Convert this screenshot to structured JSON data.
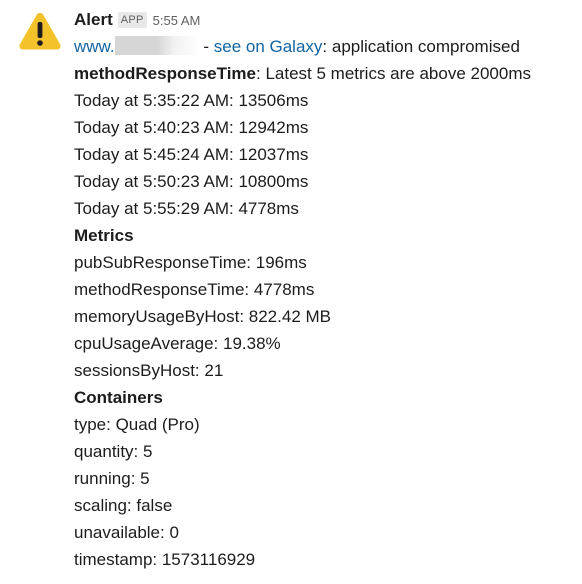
{
  "message": {
    "sender": "Alert",
    "badge": "APP",
    "time": "5:55 AM",
    "icon": "warning-icon",
    "icon_color": "#f4c22b"
  },
  "header_line": {
    "url_prefix": "www.",
    "separator": " - ",
    "galaxy_link": "see on Galaxy",
    "suffix": ": application compromised"
  },
  "alert": {
    "metric_name": "methodResponseTime",
    "metric_text": ": Latest 5 metrics are above 2000ms",
    "readings": [
      "Today at 5:35:22 AM: 13506ms",
      "Today at 5:40:23 AM: 12942ms",
      "Today at 5:45:24 AM: 12037ms",
      "Today at 5:50:23 AM: 10800ms",
      "Today at 5:55:29 AM: 4778ms"
    ]
  },
  "metrics": {
    "title": "Metrics",
    "items": [
      "pubSubResponseTime: 196ms",
      "methodResponseTime: 4778ms",
      "memoryUsageByHost: 822.42 MB",
      "cpuUsageAverage: 19.38%",
      "sessionsByHost: 21"
    ]
  },
  "containers": {
    "title": "Containers",
    "items": [
      "type: Quad (Pro)",
      "quantity: 5",
      "running: 5",
      "scaling: false",
      "unavailable: 0",
      "timestamp: 1573116929"
    ]
  },
  "colors": {
    "link": "#1264a3",
    "text": "#1d1c1d",
    "muted": "#616061"
  }
}
